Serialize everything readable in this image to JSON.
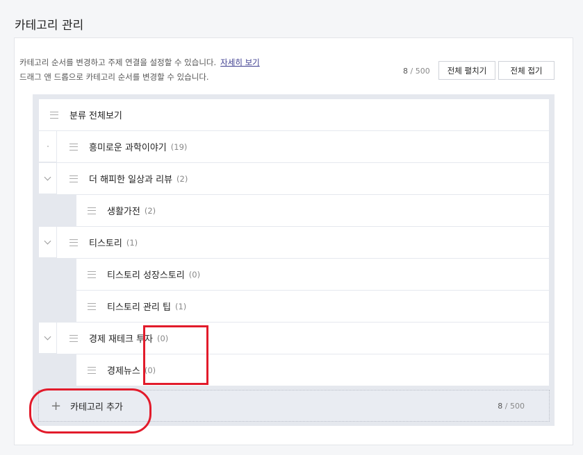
{
  "page": {
    "title": "카테고리 관리"
  },
  "description": {
    "line1": "카테고리 순서를 변경하고 주제 연결을 설정할 수 있습니다.",
    "link": "자세히 보기",
    "line2": "드래그 앤 드롭으로 카테고리 순서를 변경할 수 있습니다."
  },
  "counter": {
    "current": "8",
    "separator": "/ 500"
  },
  "buttons": {
    "expand_all": "전체 펼치기",
    "collapse_all": "전체 접기"
  },
  "tree": {
    "root": {
      "label": "분류 전체보기"
    },
    "items": [
      {
        "label": "흥미로운 과학이야기",
        "count": "(19)",
        "level": 1,
        "toggle": "dot"
      },
      {
        "label": "더 해피한 일상과 리뷰",
        "count": "(2)",
        "level": 1,
        "toggle": "chevron-down"
      },
      {
        "label": "생활가전",
        "count": "(2)",
        "level": 2
      },
      {
        "label": "티스토리",
        "count": "(1)",
        "level": 1,
        "toggle": "chevron-down"
      },
      {
        "label": "티스토리 성장스토리",
        "count": "(0)",
        "level": 2
      },
      {
        "label": "티스토리 관리 팁",
        "count": "(1)",
        "level": 2
      },
      {
        "label": "경제 재테크 투자",
        "count": "(0)",
        "level": 1,
        "toggle": "chevron-down"
      },
      {
        "label": "경제뉴스",
        "count": "(0)",
        "level": 2
      }
    ]
  },
  "add": {
    "icon": "plus-icon",
    "label": "카테고리 추가",
    "current": "8",
    "separator": "/ 500"
  },
  "colors": {
    "annotation": "#e21b2b",
    "tree_bg": "#e5e8ee",
    "accent_link": "#3d3d8f"
  }
}
